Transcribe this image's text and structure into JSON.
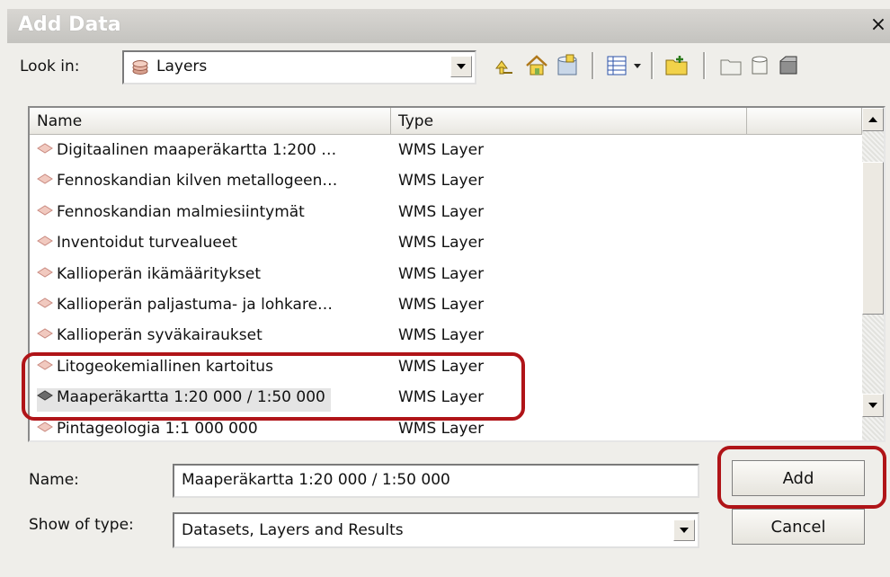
{
  "window": {
    "title": "Add Data",
    "close_glyph": "×"
  },
  "look_in": {
    "label": "Look in:",
    "value": "Layers",
    "icon": "layers-icon"
  },
  "toolbar": {
    "icons": [
      "up-one-level-icon",
      "home-icon",
      "connect-folder-icon",
      "details-view-icon",
      "new-folder-icon",
      "new-layer-icon",
      "new-database-icon",
      "new-toolbox-icon"
    ]
  },
  "list": {
    "columns": [
      "Name",
      "Type",
      ""
    ],
    "rows": [
      {
        "name": "Digitaalinen maaperäkartta 1:200 …",
        "type": "WMS Layer",
        "selected": false
      },
      {
        "name": "Fennoskandian kilven metallogeen…",
        "type": "WMS Layer",
        "selected": false
      },
      {
        "name": "Fennoskandian malmiesiintymät",
        "type": "WMS Layer",
        "selected": false
      },
      {
        "name": "Inventoidut turvealueet",
        "type": "WMS Layer",
        "selected": false
      },
      {
        "name": "Kallioperän ikämääritykset",
        "type": "WMS Layer",
        "selected": false
      },
      {
        "name": "Kallioperän paljastuma- ja lohkare…",
        "type": "WMS Layer",
        "selected": false
      },
      {
        "name": "Kallioperän syväkairaukset",
        "type": "WMS Layer",
        "selected": false
      },
      {
        "name": "Litogeokemiallinen kartoitus",
        "type": "WMS Layer",
        "selected": false
      },
      {
        "name": "Maaperäkartta 1:20 000 / 1:50 000",
        "type": "WMS Layer",
        "selected": true
      },
      {
        "name": "Pintageologia 1:1 000 000",
        "type": "WMS Layer",
        "selected": false
      }
    ]
  },
  "name_field": {
    "label": "Name:",
    "value": "Maaperäkartta 1:20 000 / 1:50 000"
  },
  "show_type": {
    "label": "Show of type:",
    "value": "Datasets, Layers and Results"
  },
  "buttons": {
    "add": "Add",
    "cancel": "Cancel"
  },
  "colors": {
    "highlight": "#b01418",
    "selected_row": "#e4e4e4",
    "layer_icon": "#c98a80"
  }
}
